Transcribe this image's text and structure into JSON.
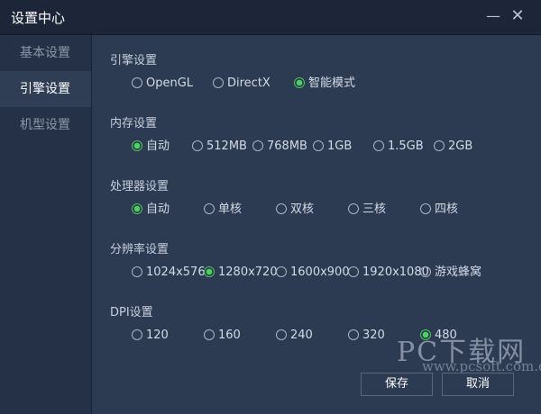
{
  "window": {
    "title": "设置中心",
    "minimize_glyph": "—",
    "close_glyph": "✕"
  },
  "sidebar": {
    "items": [
      {
        "label": "基本设置",
        "active": false
      },
      {
        "label": "引擎设置",
        "active": true
      },
      {
        "label": "机型设置",
        "active": false
      }
    ]
  },
  "sections": {
    "engine": {
      "title": "引擎设置",
      "options": [
        "OpenGL",
        "DirectX",
        "智能模式"
      ],
      "selected": "智能模式"
    },
    "memory": {
      "title": "内存设置",
      "options": [
        "自动",
        "512MB",
        "768MB",
        "1GB",
        "1.5GB",
        "2GB"
      ],
      "selected": "自动"
    },
    "cpu": {
      "title": "处理器设置",
      "options": [
        "自动",
        "单核",
        "双核",
        "三核",
        "四核"
      ],
      "selected": "自动"
    },
    "resolution": {
      "title": "分辨率设置",
      "options": [
        "1024x576",
        "1280x720",
        "1600x900",
        "1920x1080",
        "游戏蜂窝"
      ],
      "selected": "1280x720"
    },
    "dpi": {
      "title": "DPI设置",
      "options": [
        "120",
        "160",
        "240",
        "320",
        "480"
      ],
      "selected": "480"
    }
  },
  "footer": {
    "save_label": "保存",
    "cancel_label": "取消"
  },
  "watermark": {
    "main": "PC下载网",
    "url": "www.pcsoft.com.cn"
  },
  "colors": {
    "background": "#2c3a52",
    "titlebar": "#1d2638",
    "sidebar": "#253146",
    "accent_green": "#4cd35d"
  }
}
